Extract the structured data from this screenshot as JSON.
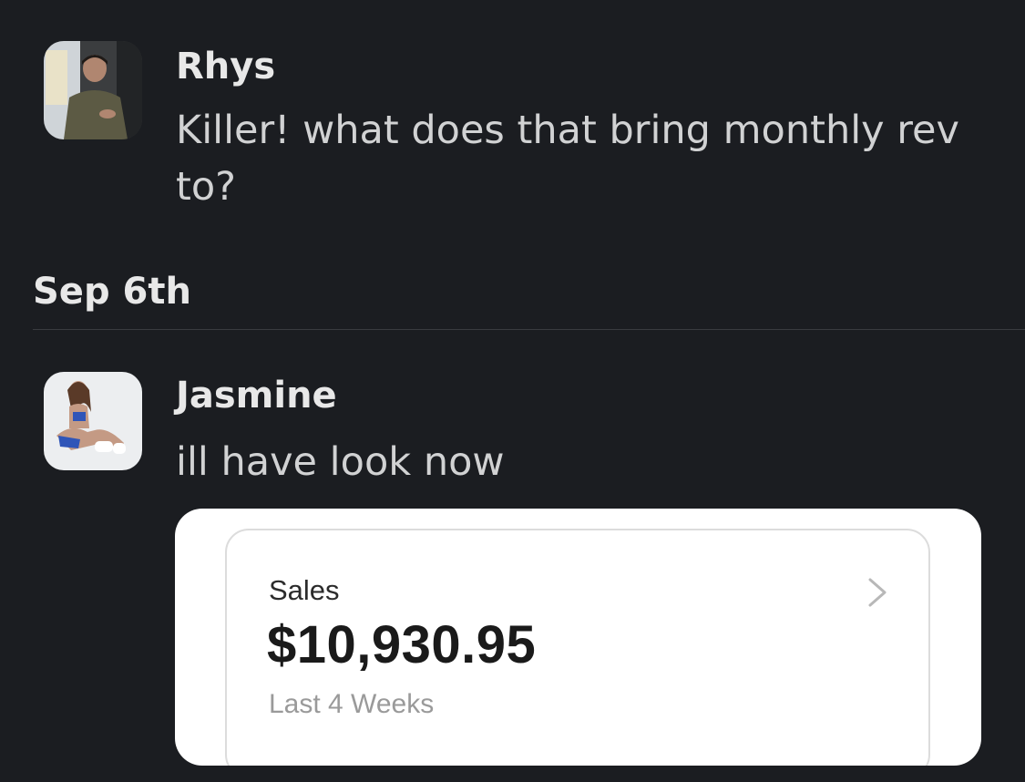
{
  "messages": [
    {
      "sender": "Rhys",
      "text": "Killer! what does that bring monthly rev to?",
      "avatar_icon": "user-avatar-photo"
    },
    {
      "sender": "Jasmine",
      "text": "ill have look now",
      "avatar_icon": "user-avatar-photo"
    }
  ],
  "date_divider": {
    "label": "Sep 6th"
  },
  "attachment": {
    "sales_title": "Sales",
    "sales_amount": "$10,930.95",
    "sales_period": "Last 4 Weeks",
    "chevron_icon": "chevron-right-icon"
  },
  "colors": {
    "background": "#1b1d21",
    "text_primary": "#e8e8e8",
    "text_secondary": "#d1d2d3",
    "divider": "#3a3c40",
    "card_background": "#ffffff"
  }
}
